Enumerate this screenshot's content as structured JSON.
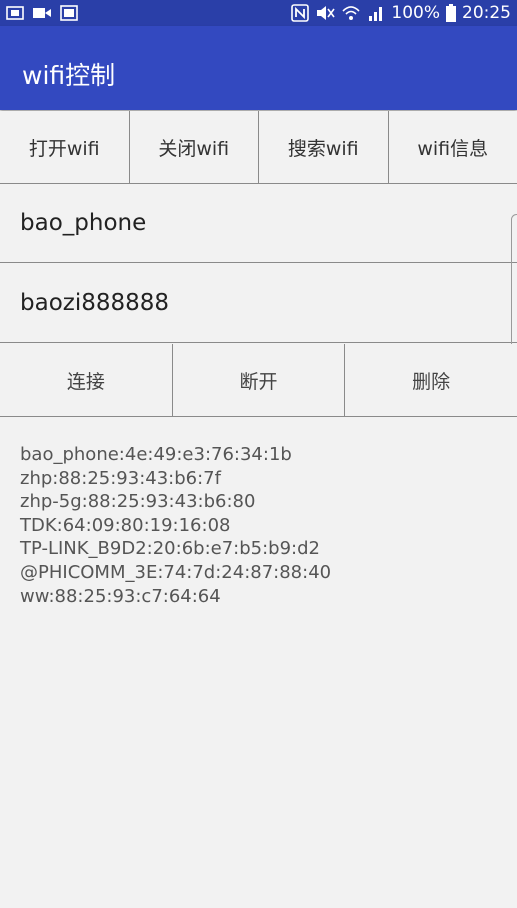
{
  "status_bar": {
    "icons_left": [
      "screenshot-icon",
      "video-icon",
      "gallery-icon"
    ],
    "icons_right": [
      "nfc-icon",
      "mute-icon",
      "wifi-icon",
      "signal-icon"
    ],
    "battery": "100%",
    "time": "20:25"
  },
  "app_bar": {
    "title": "wifi控制"
  },
  "top_buttons": [
    "打开wifi",
    "关闭wifi",
    "搜索wifi",
    "wifi信息"
  ],
  "ssid_field": {
    "value": "bao_phone"
  },
  "password_field": {
    "value": "baozi888888"
  },
  "action_buttons": [
    "连接",
    "断开",
    "删除"
  ],
  "wifi_list": [
    "bao_phone:4e:49:e3:76:34:1b",
    "zhp:88:25:93:43:b6:7f",
    "zhp-5g:88:25:93:43:b6:80",
    "TDK:64:09:80:19:16:08",
    "TP-LINK_B9D2:20:6b:e7:b5:b9:d2",
    "@PHICOMM_3E:74:7d:24:87:88:40",
    "ww:88:25:93:c7:64:64"
  ],
  "colors": {
    "status_bar": "#2a3fa8",
    "app_bar": "#3349c0",
    "background": "#f2f2f2"
  }
}
